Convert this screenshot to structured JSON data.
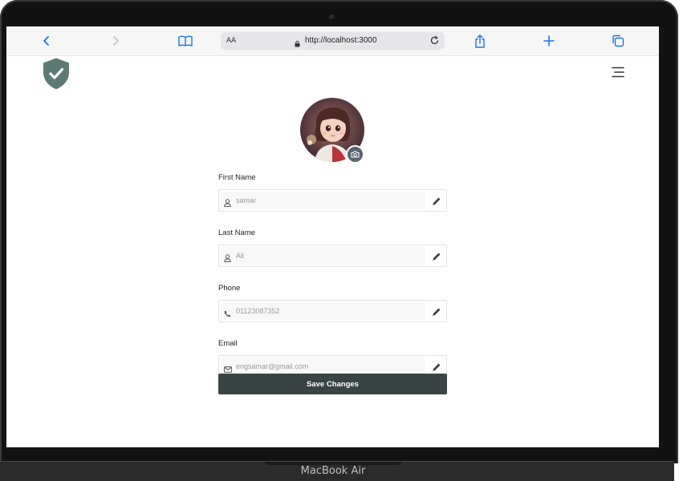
{
  "browser": {
    "url": "http://localhost:3000",
    "reader_label": "AA"
  },
  "device": {
    "label": "MacBook Air"
  },
  "form": {
    "fields": [
      {
        "label": "First Name",
        "value": "samar",
        "icon": "user-icon"
      },
      {
        "label": "Last Name",
        "value": "Ali",
        "icon": "user-icon"
      },
      {
        "label": "Phone",
        "value": "01123087352",
        "icon": "phone-icon"
      },
      {
        "label": "Email",
        "value": "engsamar@gmail.com",
        "icon": "mail-icon"
      }
    ],
    "save_label": "Save Changes"
  },
  "colors": {
    "brand": "#5b7a72",
    "button": "#3a4443",
    "accent_browser": "#1a73e8"
  }
}
